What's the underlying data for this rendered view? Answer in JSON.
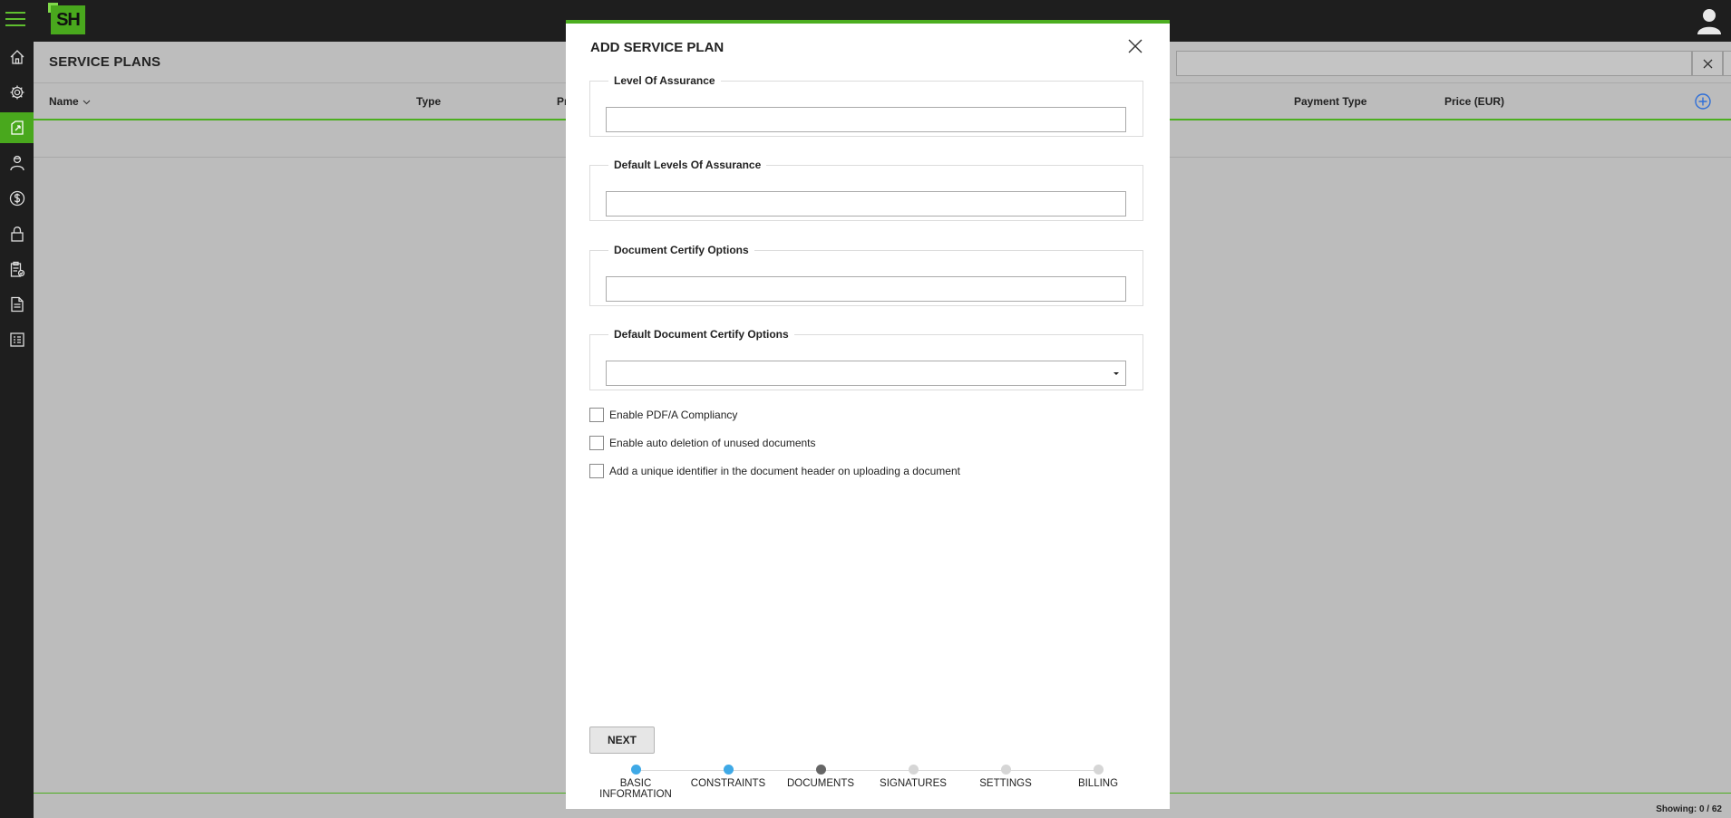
{
  "app": {
    "logo_text": "SH"
  },
  "page": {
    "title": "SERVICE PLANS",
    "columns": [
      {
        "label": "Name",
        "sortable": true
      },
      {
        "label": "Type"
      },
      {
        "label": "Pr"
      },
      {
        "label": "Payment Type"
      },
      {
        "label": "Price (EUR)"
      }
    ],
    "footer": "Showing: 0 / 62"
  },
  "rail": {
    "items": [
      {
        "icon": "home-icon"
      },
      {
        "icon": "gear-icon"
      },
      {
        "icon": "service-plan-icon",
        "active": true
      },
      {
        "icon": "user-id-icon"
      },
      {
        "icon": "dollar-icon"
      },
      {
        "icon": "lock-icon"
      },
      {
        "icon": "clipboard-check-icon"
      },
      {
        "icon": "document-icon"
      },
      {
        "icon": "report-icon"
      }
    ]
  },
  "modal": {
    "title": "ADD SERVICE PLAN",
    "groups": {
      "level_of_assurance": {
        "legend": "Level Of Assurance",
        "value": ""
      },
      "default_levels_of_assurance": {
        "legend": "Default Levels Of Assurance",
        "value": ""
      },
      "document_certify_options": {
        "legend": "Document Certify Options",
        "value": ""
      },
      "default_document_certify_options": {
        "legend": "Default Document Certify Options",
        "value": ""
      }
    },
    "checkboxes": {
      "pdfa": {
        "label": "Enable PDF/A Compliancy",
        "checked": false
      },
      "auto_delete": {
        "label": "Enable auto deletion of unused documents",
        "checked": false
      },
      "unique_id": {
        "label": "Add a unique identifier in the document header on uploading a document",
        "checked": false
      }
    },
    "next_label": "NEXT",
    "steps": [
      {
        "label": "BASIC INFORMATION",
        "state": "done"
      },
      {
        "label": "CONSTRAINTS",
        "state": "done"
      },
      {
        "label": "DOCUMENTS",
        "state": "current"
      },
      {
        "label": "SIGNATURES",
        "state": "pending"
      },
      {
        "label": "SETTINGS",
        "state": "pending"
      },
      {
        "label": "BILLING",
        "state": "pending"
      }
    ]
  },
  "colors": {
    "brand": "#49a81d",
    "accent_line": "#4cae20",
    "step_done": "#3fa9e6",
    "step_current": "#666666",
    "add_icon": "#2f6fd8"
  }
}
